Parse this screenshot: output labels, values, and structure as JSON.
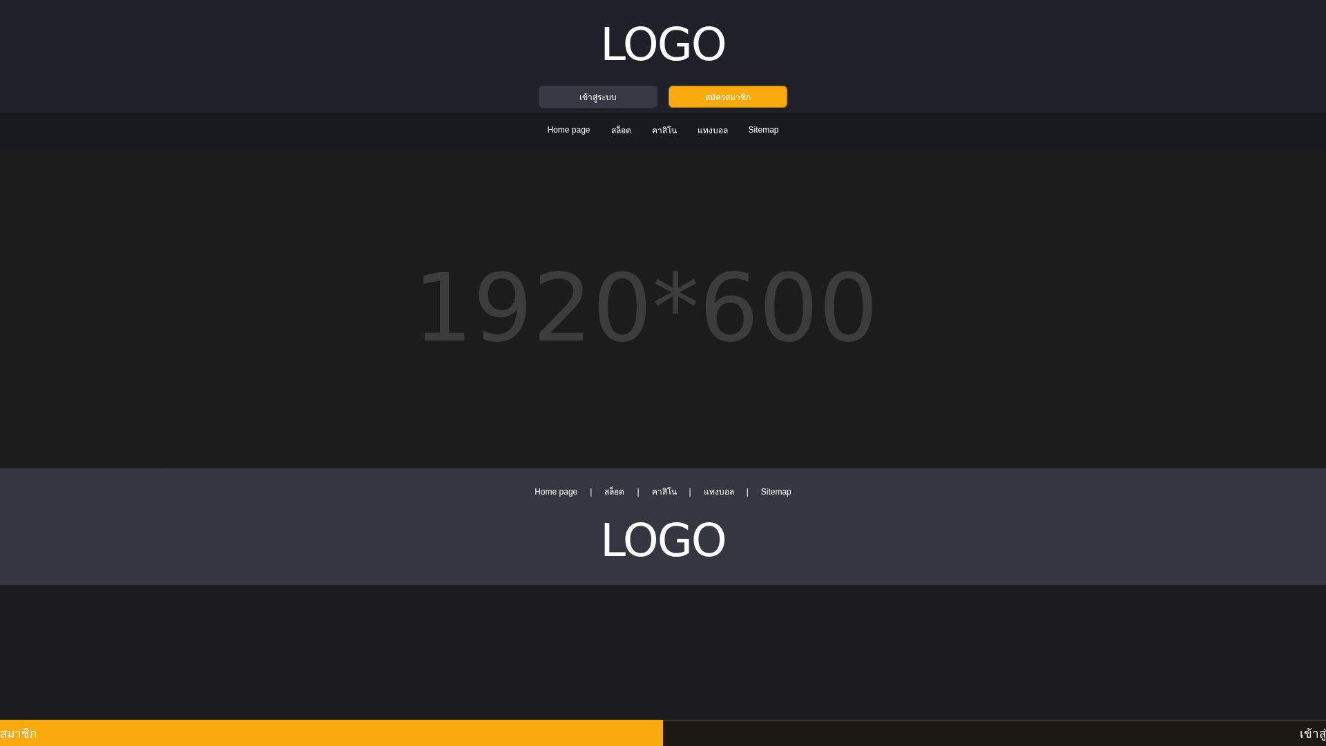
{
  "header": {
    "logo": "LOGO",
    "buttons": [
      {
        "kind": "secondary",
        "label": "เข้าสู่ระบบ"
      },
      {
        "kind": "primary",
        "label": "สมัครสมาชิก"
      }
    ]
  },
  "nav": [
    "Home page",
    "สล็อต",
    "คาสิโน",
    "แทงบอล",
    "Sitemap"
  ],
  "banner": {
    "text": "1920*600"
  },
  "footer": {
    "nav": [
      "Home page",
      "สล็อต",
      "คาสิโน",
      "แทงบอล",
      "Sitemap"
    ],
    "separator": "|",
    "logo": "LOGO"
  },
  "bottom_bar": [
    {
      "kind": "primary",
      "label": "สมาชิก"
    },
    {
      "kind": "secondary",
      "label": "เข้าสู่"
    }
  ]
}
